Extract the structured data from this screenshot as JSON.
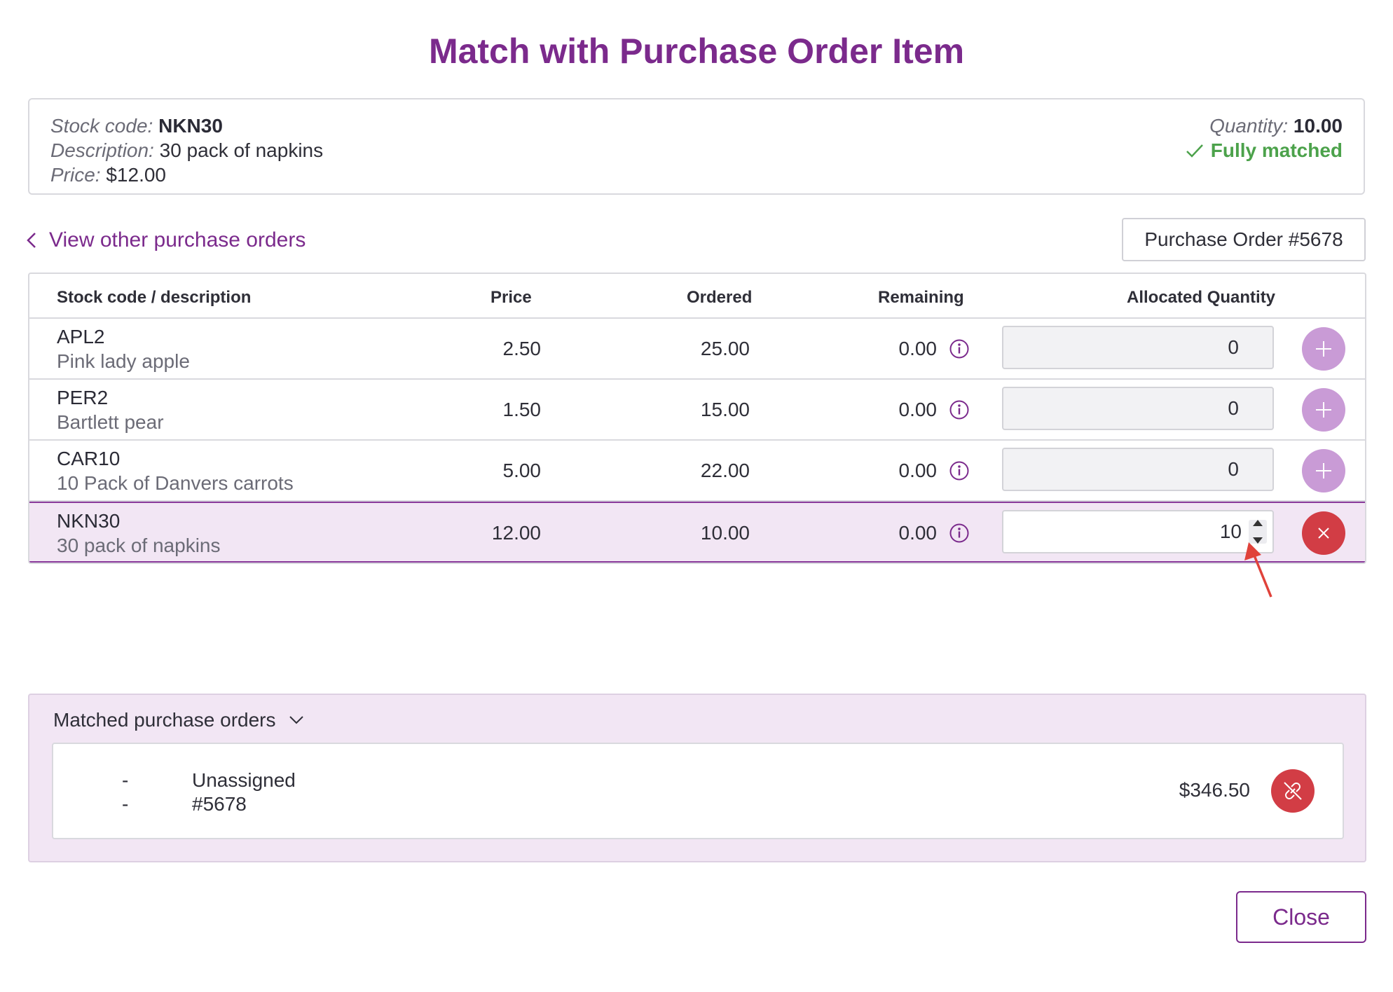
{
  "dialog": {
    "title": "Match with Purchase Order Item"
  },
  "summary": {
    "stock_code_label": "Stock code:",
    "stock_code": "NKN30",
    "description_label": "Description:",
    "description": "30 pack of napkins",
    "price_label": "Price:",
    "price": "$12.00",
    "quantity_label": "Quantity:",
    "quantity": "10.00",
    "status": "Fully matched",
    "status_color": "#4ca24b"
  },
  "nav": {
    "back_label": "View other purchase orders",
    "purchase_order_label": "Purchase Order #5678"
  },
  "table": {
    "headers": {
      "stock": "Stock code / description",
      "price": "Price",
      "ordered": "Ordered",
      "remaining": "Remaining",
      "allocated": "Allocated Quantity"
    },
    "rows": [
      {
        "code": "APL2",
        "description": "Pink lady apple",
        "price": "2.50",
        "ordered": "25.00",
        "remaining": "0.00",
        "allocated": "0"
      },
      {
        "code": "PER2",
        "description": "Bartlett pear",
        "price": "1.50",
        "ordered": "15.00",
        "remaining": "0.00",
        "allocated": "0"
      },
      {
        "code": "CAR10",
        "description": "10 Pack of Danvers carrots",
        "price": "5.00",
        "ordered": "22.00",
        "remaining": "0.00",
        "allocated": "0"
      },
      {
        "code": "NKN30",
        "description": "30 pack of napkins",
        "price": "12.00",
        "ordered": "10.00",
        "remaining": "0.00",
        "allocated": "10"
      }
    ]
  },
  "matched": {
    "header": "Matched purchase orders",
    "item": {
      "dash_1": "-",
      "dash_2": "-",
      "line_1": "Unassigned",
      "line_2": "#5678",
      "amount": "$346.50"
    }
  },
  "footer": {
    "close_label": "Close"
  },
  "colors": {
    "accent": "#7b2a8c",
    "add_button": "#c99bd6",
    "remove_button": "#d23d45",
    "selected_row": "#f2e6f4"
  }
}
